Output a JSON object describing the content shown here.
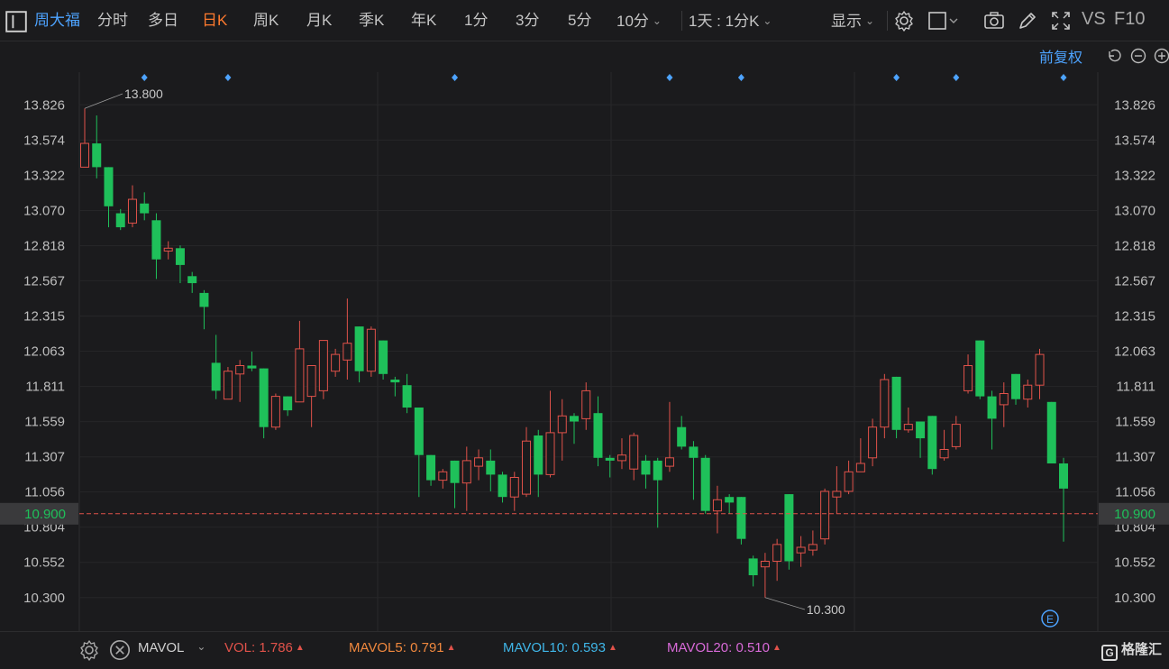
{
  "toolbar": {
    "stock_name": "周大福",
    "periods": [
      "分时",
      "多日",
      "日K",
      "周K",
      "月K",
      "季K",
      "年K",
      "1分",
      "3分",
      "5分",
      "10分"
    ],
    "active_period": "日K",
    "range_label": "1天 : 1分K",
    "display_label": "显示",
    "vs_label": "VS",
    "f10_label": "F10"
  },
  "adjust_label": "前复权",
  "chart_data": {
    "type": "candlestick",
    "y_ticks": [
      "13.826",
      "13.574",
      "13.322",
      "13.070",
      "12.818",
      "12.567",
      "12.315",
      "12.063",
      "11.811",
      "11.559",
      "11.307",
      "11.056",
      "10.804",
      "10.552",
      "10.300"
    ],
    "ylim": [
      10.06,
      14.06
    ],
    "current_price": "10.900",
    "high_label": "13.800",
    "low_label": "10.300",
    "up_color": "#e0524a",
    "down_color": "#1fc05a",
    "candles": [
      [
        13.38,
        13.55,
        13.8,
        13.38
      ],
      [
        13.55,
        13.38,
        13.75,
        13.3
      ],
      [
        13.38,
        13.1,
        13.38,
        12.95
      ],
      [
        13.05,
        12.95,
        13.08,
        12.93
      ],
      [
        12.98,
        13.15,
        13.25,
        12.95
      ],
      [
        13.12,
        13.05,
        13.2,
        13.0
      ],
      [
        13.0,
        12.72,
        13.05,
        12.58
      ],
      [
        12.78,
        12.8,
        12.85,
        12.72
      ],
      [
        12.8,
        12.68,
        12.82,
        12.55
      ],
      [
        12.6,
        12.55,
        12.63,
        12.48
      ],
      [
        12.48,
        12.38,
        12.5,
        12.22
      ],
      [
        11.98,
        11.78,
        12.18,
        11.72
      ],
      [
        11.72,
        11.92,
        11.95,
        11.72
      ],
      [
        11.9,
        11.96,
        12.0,
        11.7
      ],
      [
        11.96,
        11.94,
        12.06,
        11.92
      ],
      [
        11.94,
        11.52,
        11.94,
        11.44
      ],
      [
        11.52,
        11.74,
        11.76,
        11.5
      ],
      [
        11.74,
        11.64,
        11.74,
        11.6
      ],
      [
        11.7,
        12.08,
        12.28,
        11.7
      ],
      [
        11.74,
        11.96,
        11.96,
        11.52
      ],
      [
        11.78,
        12.14,
        12.14,
        11.72
      ],
      [
        11.92,
        12.04,
        12.08,
        11.88
      ],
      [
        12.0,
        12.12,
        12.44,
        11.86
      ],
      [
        12.24,
        11.92,
        12.24,
        11.84
      ],
      [
        11.92,
        12.22,
        12.24,
        11.88
      ],
      [
        12.14,
        11.9,
        12.14,
        11.86
      ],
      [
        11.86,
        11.84,
        11.88,
        11.74
      ],
      [
        11.82,
        11.66,
        11.9,
        11.62
      ],
      [
        11.66,
        11.32,
        11.66,
        11.02
      ],
      [
        11.32,
        11.14,
        11.32,
        11.1
      ],
      [
        11.14,
        11.2,
        11.22,
        11.08
      ],
      [
        11.28,
        11.12,
        11.28,
        10.94
      ],
      [
        11.12,
        11.28,
        11.38,
        10.92
      ],
      [
        11.24,
        11.3,
        11.36,
        11.14
      ],
      [
        11.28,
        11.18,
        11.36,
        11.06
      ],
      [
        11.18,
        11.02,
        11.2,
        10.98
      ],
      [
        11.02,
        11.16,
        11.2,
        10.92
      ],
      [
        11.04,
        11.42,
        11.52,
        11.02
      ],
      [
        11.46,
        11.18,
        11.5,
        11.02
      ],
      [
        11.18,
        11.48,
        11.78,
        11.16
      ],
      [
        11.48,
        11.6,
        11.72,
        11.28
      ],
      [
        11.6,
        11.56,
        11.62,
        11.4
      ],
      [
        11.58,
        11.78,
        11.84,
        11.5
      ],
      [
        11.62,
        11.3,
        11.74,
        11.24
      ],
      [
        11.3,
        11.28,
        11.32,
        11.16
      ],
      [
        11.28,
        11.32,
        11.44,
        11.22
      ],
      [
        11.22,
        11.46,
        11.48,
        11.14
      ],
      [
        11.28,
        11.18,
        11.32,
        11.08
      ],
      [
        11.28,
        11.14,
        11.3,
        10.8
      ],
      [
        11.24,
        11.3,
        11.7,
        11.2
      ],
      [
        11.52,
        11.38,
        11.6,
        11.36
      ],
      [
        11.38,
        11.3,
        11.42,
        11.0
      ],
      [
        11.3,
        10.92,
        11.32,
        10.9
      ],
      [
        10.92,
        11.0,
        11.1,
        10.76
      ],
      [
        11.02,
        10.98,
        11.04,
        10.9
      ],
      [
        11.02,
        10.72,
        11.02,
        10.68
      ],
      [
        10.58,
        10.46,
        10.6,
        10.38
      ],
      [
        10.52,
        10.56,
        10.62,
        10.3
      ],
      [
        10.56,
        10.68,
        10.72,
        10.42
      ],
      [
        11.04,
        10.56,
        11.04,
        10.5
      ],
      [
        10.62,
        10.66,
        10.74,
        10.52
      ],
      [
        10.64,
        10.68,
        10.78,
        10.6
      ],
      [
        10.72,
        11.06,
        11.08,
        10.68
      ],
      [
        11.02,
        11.06,
        11.24,
        10.9
      ],
      [
        11.06,
        11.2,
        11.28,
        11.04
      ],
      [
        11.2,
        11.26,
        11.44,
        11.2
      ],
      [
        11.3,
        11.52,
        11.58,
        11.24
      ],
      [
        11.52,
        11.86,
        11.9,
        11.44
      ],
      [
        11.88,
        11.5,
        11.88,
        11.44
      ],
      [
        11.5,
        11.54,
        11.66,
        11.48
      ],
      [
        11.56,
        11.44,
        11.56,
        11.3
      ],
      [
        11.6,
        11.22,
        11.6,
        11.18
      ],
      [
        11.3,
        11.36,
        11.5,
        11.28
      ],
      [
        11.38,
        11.54,
        11.6,
        11.36
      ],
      [
        11.78,
        11.96,
        12.04,
        11.76
      ],
      [
        12.14,
        11.74,
        12.14,
        11.72
      ],
      [
        11.74,
        11.58,
        11.78,
        11.36
      ],
      [
        11.68,
        11.76,
        11.84,
        11.52
      ],
      [
        11.9,
        11.72,
        11.9,
        11.68
      ],
      [
        11.72,
        11.82,
        11.86,
        11.66
      ],
      [
        11.82,
        12.04,
        12.08,
        11.72
      ],
      [
        11.7,
        11.26,
        11.7,
        11.26
      ],
      [
        11.26,
        11.08,
        11.3,
        10.7
      ]
    ],
    "markers": [
      5,
      12,
      31,
      49,
      55,
      68,
      73,
      82
    ],
    "high_index": 0,
    "low_index": 57
  },
  "indicator": {
    "name": "MAVOL",
    "vol_label": "VOL:",
    "vol_value": "1.786",
    "mavol5_label": "MAVOL5:",
    "mavol5_value": "0.791",
    "mavol10_label": "MAVOL10:",
    "mavol10_value": "0.593",
    "mavol20_label": "MAVOL20:",
    "mavol20_value": "0.510",
    "vol_color": "#e0524a",
    "mavol5_color": "#f0883e",
    "mavol10_color": "#3fb6e8",
    "mavol20_color": "#d86ad8"
  },
  "logo_text": "格隆汇",
  "e_badge": "E"
}
